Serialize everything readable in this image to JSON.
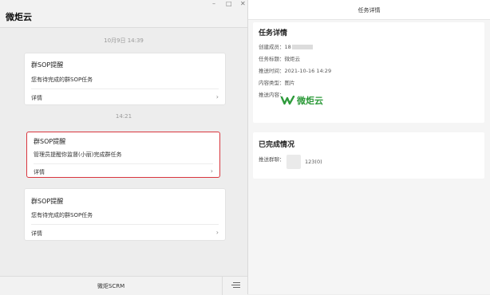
{
  "window": {
    "title": "微炬云",
    "min": "–",
    "max": "□",
    "close": "✕"
  },
  "chat": {
    "timestamps": [
      "10月9日 14:39",
      "14:21"
    ],
    "cards": [
      {
        "title": "群SOP提醒",
        "body": "您有待完成的群SOP任务",
        "detail": "详情",
        "chevron": "›"
      },
      {
        "title": "群SOP提醒",
        "body": "管理员提醒你监督(小丽)完成群任务",
        "detail": "详情",
        "chevron": "›"
      },
      {
        "title": "群SOP提醒",
        "body": "您有待完成的群SOP任务",
        "detail": "详情",
        "chevron": "›"
      }
    ],
    "bottom_label": "微炬SCRM",
    "menu_icon": "list-menu-icon"
  },
  "detail_panel": {
    "header": "任务详情",
    "task": {
      "title": "任务详情",
      "creator_label": "创建成员：",
      "creator_value": "18",
      "task_title_label": "任务标题：",
      "task_title_value": "微炬云",
      "push_time_label": "推送时间：",
      "push_time_value": "2021-10-16 14:29",
      "content_type_label": "内容类型：",
      "content_type_value": "图片",
      "push_content_label": "推送内容：",
      "push_content_logo_text": "微炬云"
    },
    "completion": {
      "title": "已完成情况",
      "group_label": "推送群聊：",
      "group_count": "123(0)"
    }
  },
  "colors": {
    "accent_red": "#d9363e",
    "logo_green": "#2f9b3c"
  }
}
